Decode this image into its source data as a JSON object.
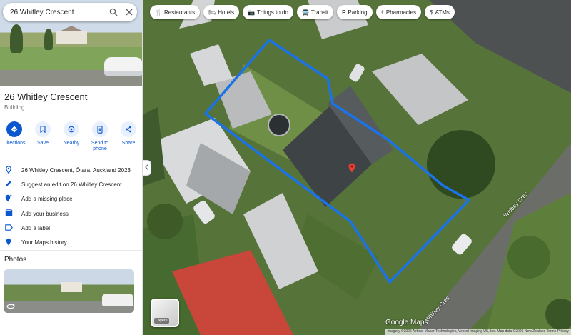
{
  "search": {
    "query": "26 Whitley Crescent"
  },
  "place": {
    "title": "26 Whitley Crescent",
    "category": "Building"
  },
  "actions": [
    {
      "label": "Directions",
      "icon": "directions-icon"
    },
    {
      "label": "Save",
      "icon": "bookmark-icon"
    },
    {
      "label": "Nearby",
      "icon": "nearby-icon"
    },
    {
      "label": "Send to phone",
      "icon": "phone-icon"
    },
    {
      "label": "Share",
      "icon": "share-icon"
    }
  ],
  "info_rows": [
    {
      "text": "26 Whitley Crescent, Ōtara, Auckland 2023",
      "icon": "location-pin-icon"
    },
    {
      "text": "Suggest an edit on 26 Whitley Crescent",
      "icon": "edit-pencil-icon"
    },
    {
      "text": "Add a missing place",
      "icon": "add-place-icon"
    },
    {
      "text": "Add your business",
      "icon": "business-icon"
    },
    {
      "text": "Add a label",
      "icon": "label-icon"
    },
    {
      "text": "Your Maps history",
      "icon": "history-icon"
    }
  ],
  "photos": {
    "heading": "Photos"
  },
  "chips": [
    {
      "label": "Restaurants",
      "icon": "restaurant-icon"
    },
    {
      "label": "Hotels",
      "icon": "hotel-icon"
    },
    {
      "label": "Things to do",
      "icon": "camera-icon"
    },
    {
      "label": "Transit",
      "icon": "transit-icon"
    },
    {
      "label": "Parking",
      "icon": "parking-icon"
    },
    {
      "label": "Pharmacies",
      "icon": "pharmacy-icon"
    },
    {
      "label": "ATMs",
      "icon": "atm-icon"
    }
  ],
  "map": {
    "layers_label": "Layers",
    "logo": "Google Maps",
    "attribution": "Imagery ©2026 Airbus, Maxar Technologies, Vexcel Imaging US, Inc. Map data ©2026  New Zealand  Terms  Privacy",
    "street_labels": [
      "Whitley Cres",
      "Whitley Cres"
    ],
    "boundary_color": "#1a73e8",
    "pin_color": "#ea4335"
  },
  "colors": {
    "accent": "#0b57d0"
  }
}
